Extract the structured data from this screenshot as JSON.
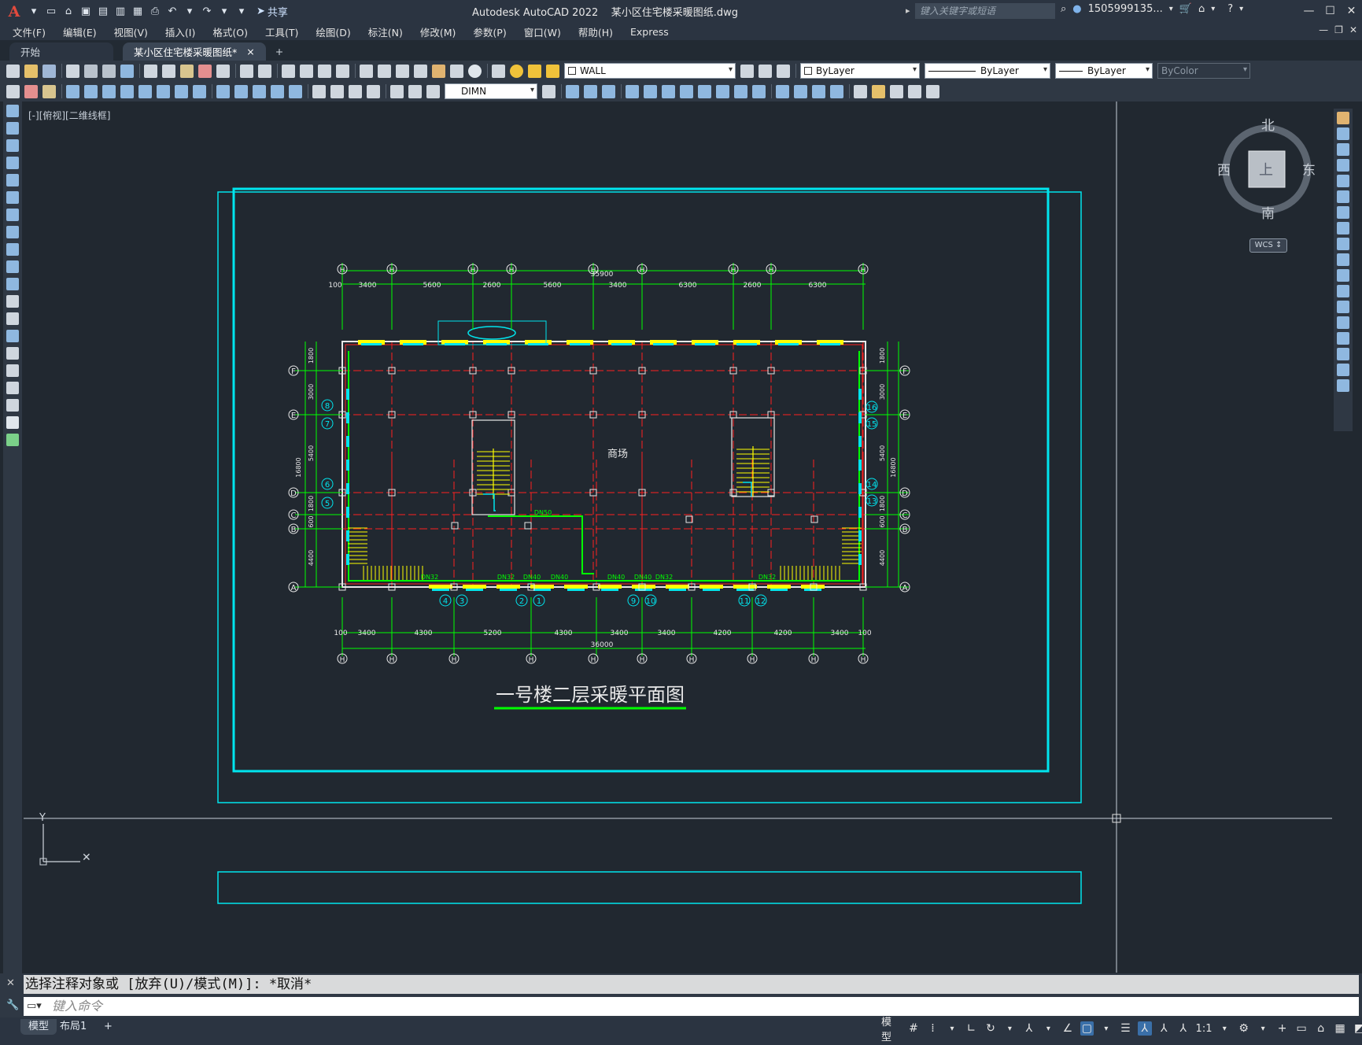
{
  "titlebar": {
    "share_label": "共享",
    "title": "Autodesk AutoCAD 2022    某小区住宅楼采暖图纸.dwg",
    "search_placeholder": "键入关键字或短语",
    "user": "1505999135..."
  },
  "menu": [
    "文件(F)",
    "编辑(E)",
    "视图(V)",
    "插入(I)",
    "格式(O)",
    "工具(T)",
    "绘图(D)",
    "标注(N)",
    "修改(M)",
    "参数(P)",
    "窗口(W)",
    "帮助(H)",
    "Express"
  ],
  "tabs": {
    "start": "开始",
    "document": "某小区住宅楼采暖图纸*",
    "close": "×",
    "add": "+"
  },
  "toolbar": {
    "layer": "WALL",
    "color": "ByLayer",
    "linetype": "ByLayer",
    "lineweight": "ByLayer",
    "plotstyle": "ByColor",
    "dimstyle": "DIMN"
  },
  "viewport": {
    "label": "[-][俯视][二维线框]",
    "compass": {
      "north": "北",
      "south": "南",
      "east": "东",
      "west": "西",
      "face": "上"
    },
    "wcs": "WCS ↕"
  },
  "drawing": {
    "title": "一号楼二层采暖平面图",
    "room_label": "商场",
    "top_overall": "35900",
    "bottom_overall": "36000",
    "top_dims": [
      "100",
      "3400",
      "5600",
      "2600",
      "5600",
      "3400",
      "6300",
      "2600",
      "6300"
    ],
    "bottom_dims": [
      "100",
      "3400",
      "4300",
      "5200",
      "4300",
      "3400",
      "3400",
      "4200",
      "4200",
      "3400",
      "100"
    ],
    "left_dims": [
      "1800",
      "3000",
      "5400",
      "1800",
      "600",
      "4400"
    ],
    "left_overall": "16800",
    "right_dims": [
      "1800",
      "3000",
      "5400",
      "1800",
      "600",
      "4400"
    ],
    "right_overall": "16800",
    "row_axes": [
      "F",
      "E",
      "D",
      "C",
      "B",
      "A"
    ],
    "col_axes_top": [
      "H",
      "H",
      "H",
      "H",
      "H",
      "H",
      "H",
      "H",
      "H"
    ],
    "col_axes_bottom": [
      "H",
      "H",
      "H",
      "H",
      "H",
      "H",
      "H",
      "H",
      "H",
      "H",
      "H"
    ],
    "radiators_bottom": [
      "4",
      "3",
      "2",
      "1",
      "9",
      "10",
      "11",
      "12"
    ],
    "radiators_left": [
      "8",
      "7",
      "6",
      "5"
    ],
    "radiators_right": [
      "16",
      "15",
      "14",
      "13"
    ],
    "pipe_labels": [
      "DN50",
      "DN32",
      "DN40",
      "DN40",
      "DN40",
      "DN40",
      "DN32",
      "DN32",
      "DN32"
    ]
  },
  "command": {
    "history": "选择注释对象或 [放弃(U)/模式(M)]: *取消*",
    "placeholder": "键入命令"
  },
  "status": {
    "layout_tabs": [
      "模型",
      "布局1"
    ],
    "add": "+",
    "model": "模型",
    "scale": "1:1"
  }
}
